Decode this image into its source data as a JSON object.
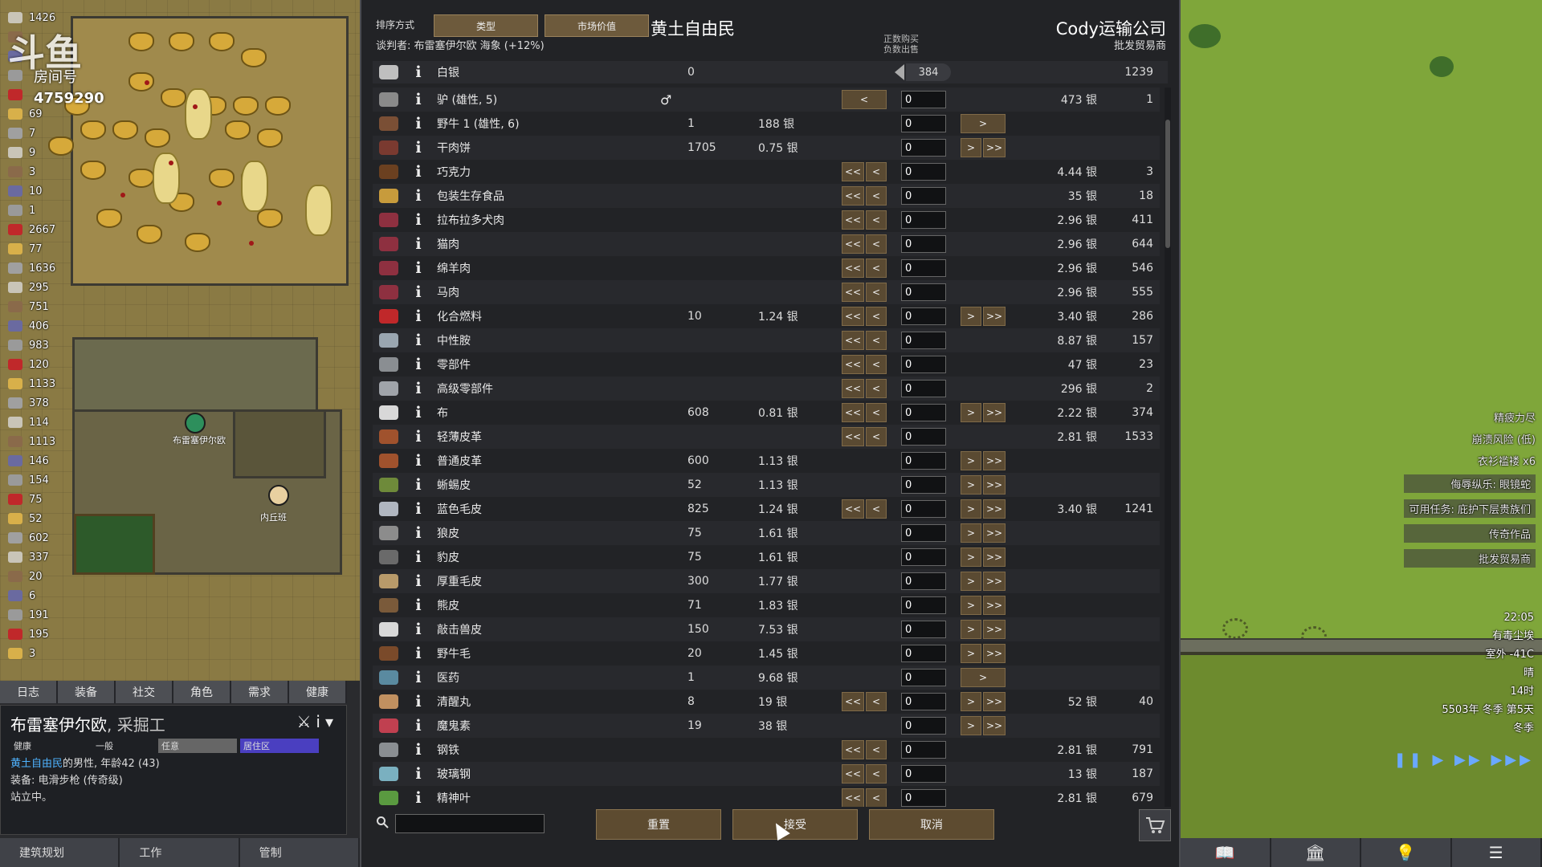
{
  "hud": {
    "logo_text": "斗鱼",
    "room_label": "房间号",
    "room_number": "4759290"
  },
  "resources": [
    {
      "icon": "silver-icon",
      "value": "1426"
    },
    {
      "icon": "",
      "value": ""
    },
    {
      "icon": "",
      "value": ""
    },
    {
      "icon": "",
      "value": ""
    },
    {
      "icon": "",
      "value": ""
    },
    {
      "icon": "",
      "value": "69"
    },
    {
      "icon": "",
      "value": "7"
    },
    {
      "icon": "",
      "value": "9"
    },
    {
      "icon": "",
      "value": "3"
    },
    {
      "icon": "",
      "value": "10"
    },
    {
      "icon": "",
      "value": "1"
    },
    {
      "icon": "",
      "value": "2667"
    },
    {
      "icon": "",
      "value": "77"
    },
    {
      "icon": "",
      "value": "1636"
    },
    {
      "icon": "",
      "value": "295"
    },
    {
      "icon": "",
      "value": "751"
    },
    {
      "icon": "",
      "value": "406"
    },
    {
      "icon": "",
      "value": "983"
    },
    {
      "icon": "",
      "value": "120"
    },
    {
      "icon": "",
      "value": "1133"
    },
    {
      "icon": "",
      "value": "378"
    },
    {
      "icon": "",
      "value": "114"
    },
    {
      "icon": "",
      "value": "1113"
    },
    {
      "icon": "",
      "value": "146"
    },
    {
      "icon": "",
      "value": "154"
    },
    {
      "icon": "",
      "value": "75"
    },
    {
      "icon": "",
      "value": "52"
    },
    {
      "icon": "",
      "value": "602"
    },
    {
      "icon": "",
      "value": "337"
    },
    {
      "icon": "",
      "value": "20"
    },
    {
      "icon": "",
      "value": "6"
    },
    {
      "icon": "",
      "value": "191"
    },
    {
      "icon": "",
      "value": "195"
    },
    {
      "icon": "",
      "value": "3"
    }
  ],
  "pawn_labels": [
    "布雷塞伊尔欧",
    "内丘班"
  ],
  "left_tabs": [
    "日志",
    "装备",
    "社交",
    "角色",
    "需求",
    "健康"
  ],
  "inspect": {
    "name": "布雷塞伊尔欧",
    "job": ", 采掘工",
    "bar_labels": [
      "健康",
      "一般",
      "任意",
      "居住区"
    ],
    "faction": "黄土自由民",
    "desc_suffix": "的男性, 年龄42 (43)",
    "equipment": "装备: 电滑步枪 (传奇级)",
    "status": "站立中。"
  },
  "bottom_left": [
    "建筑规划",
    "工作",
    "管制"
  ],
  "dialog": {
    "sort_label": "排序方式",
    "sort_buttons": [
      "类型",
      "市场价值"
    ],
    "negotiator": "谈判者: 布雷塞伊尔欧 海象 (+12%)",
    "colony_title": "黄土自由民",
    "hint": "正数购买\n负数出售",
    "trader_title": "Cody运输公司",
    "trader_sub": "批发贸易商",
    "silver": {
      "label": "白银",
      "colony_qty": "0",
      "count": "384",
      "trader_qty": "1239"
    },
    "search_placeholder": "",
    "reset": "重置",
    "accept": "接受",
    "cancel": "取消"
  },
  "items": [
    {
      "name": "驴 (雄性, 5)",
      "icon_color": "#8a8a8a",
      "qty": "",
      "price": "",
      "left": "single",
      "count": "0",
      "right": "none",
      "tprice": "473 银",
      "tqty": "1"
    },
    {
      "name": "野牛 1 (雄性, 6)",
      "icon_color": "#7a4f35",
      "qty": "1",
      "price": "188 银",
      "left": "none",
      "count": "0",
      "right": "single",
      "tprice": "",
      "tqty": ""
    },
    {
      "name": "干肉饼",
      "icon_color": "#7a3a30",
      "qty": "1705",
      "price": "0.75 银",
      "left": "none",
      "count": "0",
      "right": "both",
      "tprice": "",
      "tqty": ""
    },
    {
      "name": "巧克力",
      "icon_color": "#6b4020",
      "qty": "",
      "price": "",
      "left": "both",
      "count": "0",
      "right": "none",
      "tprice": "4.44 银",
      "tqty": "3"
    },
    {
      "name": "包装生存食品",
      "icon_color": "#c79b3c",
      "qty": "",
      "price": "",
      "left": "both",
      "count": "0",
      "right": "none",
      "tprice": "35 银",
      "tqty": "18"
    },
    {
      "name": "拉布拉多犬肉",
      "icon_color": "#8e3040",
      "qty": "",
      "price": "",
      "left": "both",
      "count": "0",
      "right": "none",
      "tprice": "2.96 银",
      "tqty": "411"
    },
    {
      "name": "猫肉",
      "icon_color": "#8e3040",
      "qty": "",
      "price": "",
      "left": "both",
      "count": "0",
      "right": "none",
      "tprice": "2.96 银",
      "tqty": "644"
    },
    {
      "name": "绵羊肉",
      "icon_color": "#8e3040",
      "qty": "",
      "price": "",
      "left": "both",
      "count": "0",
      "right": "none",
      "tprice": "2.96 银",
      "tqty": "546"
    },
    {
      "name": "马肉",
      "icon_color": "#8e3040",
      "qty": "",
      "price": "",
      "left": "both",
      "count": "0",
      "right": "none",
      "tprice": "2.96 银",
      "tqty": "555"
    },
    {
      "name": "化合燃料",
      "icon_color": "#c0282a",
      "qty": "10",
      "price": "1.24 银",
      "left": "both",
      "count": "0",
      "right": "both",
      "tprice": "3.40 银",
      "tqty": "286"
    },
    {
      "name": "中性胺",
      "icon_color": "#9aa6b0",
      "qty": "",
      "price": "",
      "left": "both",
      "count": "0",
      "right": "none",
      "tprice": "8.87 银",
      "tqty": "157"
    },
    {
      "name": "零部件",
      "icon_color": "#8a8e92",
      "qty": "",
      "price": "",
      "left": "both",
      "count": "0",
      "right": "none",
      "tprice": "47 银",
      "tqty": "23"
    },
    {
      "name": "高级零部件",
      "icon_color": "#a0a4aa",
      "qty": "",
      "price": "",
      "left": "both",
      "count": "0",
      "right": "none",
      "tprice": "296 银",
      "tqty": "2"
    },
    {
      "name": "布",
      "icon_color": "#d8d8d8",
      "qty": "608",
      "price": "0.81 银",
      "left": "both",
      "count": "0",
      "right": "both",
      "tprice": "2.22 银",
      "tqty": "374"
    },
    {
      "name": "轻薄皮革",
      "icon_color": "#a0522d",
      "qty": "",
      "price": "",
      "left": "both",
      "count": "0",
      "right": "none",
      "tprice": "2.81 银",
      "tqty": "1533"
    },
    {
      "name": "普通皮革",
      "icon_color": "#a0522d",
      "qty": "600",
      "price": "1.13 银",
      "left": "none",
      "count": "0",
      "right": "both",
      "tprice": "",
      "tqty": ""
    },
    {
      "name": "蜥蜴皮",
      "icon_color": "#6e8a3a",
      "qty": "52",
      "price": "1.13 银",
      "left": "none",
      "count": "0",
      "right": "both",
      "tprice": "",
      "tqty": ""
    },
    {
      "name": "蓝色毛皮",
      "icon_color": "#b0b6c0",
      "qty": "825",
      "price": "1.24 银",
      "left": "both",
      "count": "0",
      "right": "both",
      "tprice": "3.40 银",
      "tqty": "1241"
    },
    {
      "name": "狼皮",
      "icon_color": "#8c8c8c",
      "qty": "75",
      "price": "1.61 银",
      "left": "none",
      "count": "0",
      "right": "both",
      "tprice": "",
      "tqty": ""
    },
    {
      "name": "豹皮",
      "icon_color": "#6a6a6a",
      "qty": "75",
      "price": "1.61 银",
      "left": "none",
      "count": "0",
      "right": "both",
      "tprice": "",
      "tqty": ""
    },
    {
      "name": "厚重毛皮",
      "icon_color": "#b89a6a",
      "qty": "300",
      "price": "1.77 银",
      "left": "none",
      "count": "0",
      "right": "both",
      "tprice": "",
      "tqty": ""
    },
    {
      "name": "熊皮",
      "icon_color": "#7a5a3a",
      "qty": "71",
      "price": "1.83 银",
      "left": "none",
      "count": "0",
      "right": "both",
      "tprice": "",
      "tqty": ""
    },
    {
      "name": "敲击兽皮",
      "icon_color": "#d8d8d8",
      "qty": "150",
      "price": "7.53 银",
      "left": "none",
      "count": "0",
      "right": "both",
      "tprice": "",
      "tqty": ""
    },
    {
      "name": "野牛毛",
      "icon_color": "#7a4a2a",
      "qty": "20",
      "price": "1.45 银",
      "left": "none",
      "count": "0",
      "right": "both",
      "tprice": "",
      "tqty": ""
    },
    {
      "name": "医药",
      "icon_color": "#5a8aa0",
      "qty": "1",
      "price": "9.68 银",
      "left": "none",
      "count": "0",
      "right": "single",
      "tprice": "",
      "tqty": ""
    },
    {
      "name": "清醒丸",
      "icon_color": "#c09060",
      "qty": "8",
      "price": "19 银",
      "left": "both",
      "count": "0",
      "right": "both",
      "tprice": "52 银",
      "tqty": "40"
    },
    {
      "name": "魔鬼素",
      "icon_color": "#c04050",
      "qty": "19",
      "price": "38 银",
      "left": "none",
      "count": "0",
      "right": "both",
      "tprice": "",
      "tqty": ""
    },
    {
      "name": "钢铁",
      "icon_color": "#8a8e92",
      "qty": "",
      "price": "",
      "left": "both",
      "count": "0",
      "right": "none",
      "tprice": "2.81 银",
      "tqty": "791"
    },
    {
      "name": "玻璃钢",
      "icon_color": "#7ab0c0",
      "qty": "",
      "price": "",
      "left": "both",
      "count": "0",
      "right": "none",
      "tprice": "13 银",
      "tqty": "187"
    },
    {
      "name": "精神叶",
      "icon_color": "#5a9a40",
      "qty": "",
      "price": "",
      "left": "both",
      "count": "0",
      "right": "none",
      "tprice": "2.81 银",
      "tqty": "679"
    }
  ],
  "alerts": [
    "精疲力尽",
    "崩溃风险 (低)",
    "衣衫褴褛 x6",
    "侮辱纵乐: 眼镜蛇",
    "可用任务: 庇护下层贵族们",
    "传奇作品",
    "批发贸易商"
  ],
  "time": [
    "22:05",
    "有毒尘埃",
    "室外 -41C",
    "晴",
    "14时",
    "5503年 冬季 第5天",
    "冬季"
  ],
  "colors": {
    "panel_bg": "#222326",
    "button": "#5a4a32",
    "faction_blue": "#4fb3ff",
    "grass": "#7fa63a"
  }
}
